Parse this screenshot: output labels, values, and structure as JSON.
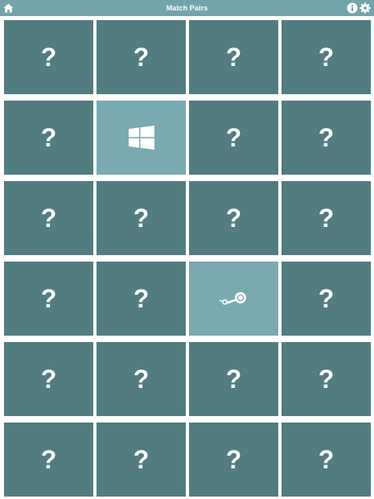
{
  "app": {
    "title": "Match Pairs"
  },
  "colors": {
    "topbar": "#74a4ab",
    "card_hidden": "#517d80",
    "card_revealed": "#79aab1",
    "icon": "#ffffff"
  },
  "toolbar": {
    "home_icon": "home-icon",
    "info_icon": "info-icon",
    "settings_icon": "gear-icon"
  },
  "board": {
    "rows": 6,
    "cols": 4,
    "hidden_symbol": "?",
    "cards": [
      {
        "state": "hidden"
      },
      {
        "state": "hidden"
      },
      {
        "state": "hidden"
      },
      {
        "state": "hidden"
      },
      {
        "state": "hidden"
      },
      {
        "state": "revealed",
        "icon": "windows-logo-icon"
      },
      {
        "state": "hidden"
      },
      {
        "state": "hidden"
      },
      {
        "state": "hidden"
      },
      {
        "state": "hidden"
      },
      {
        "state": "hidden"
      },
      {
        "state": "hidden"
      },
      {
        "state": "hidden"
      },
      {
        "state": "hidden"
      },
      {
        "state": "revealed",
        "icon": "steam-logo-icon"
      },
      {
        "state": "hidden"
      },
      {
        "state": "hidden"
      },
      {
        "state": "hidden"
      },
      {
        "state": "hidden"
      },
      {
        "state": "hidden"
      },
      {
        "state": "hidden"
      },
      {
        "state": "hidden"
      },
      {
        "state": "hidden"
      },
      {
        "state": "hidden"
      }
    ]
  }
}
